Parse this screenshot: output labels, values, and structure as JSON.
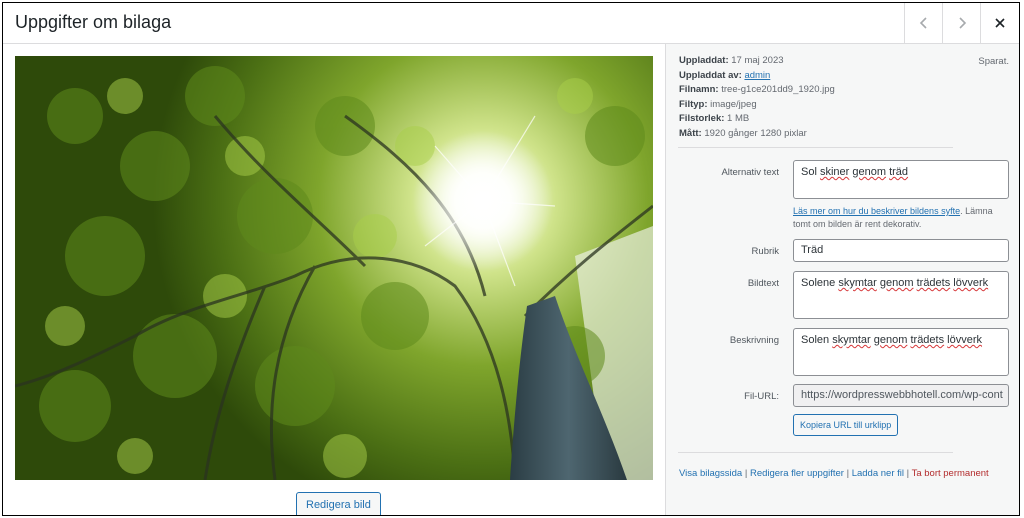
{
  "modal": {
    "title": "Uppgifter om bilaga",
    "prev_icon": "chevron-left-icon",
    "next_icon": "chevron-right-icon",
    "close_icon": "close-icon"
  },
  "image": {
    "alt": "Sol skiner genom träd",
    "edit_button": "Redigera bild"
  },
  "details": {
    "saved": "Sparat.",
    "uploaded_label": "Uppladdat:",
    "uploaded_value": "17 maj 2023",
    "uploaded_by_label": "Uppladdat av:",
    "uploaded_by_value": "admin",
    "filename_label": "Filnamn:",
    "filename_value": "tree-g1ce201dd9_1920.jpg",
    "filetype_label": "Filtyp:",
    "filetype_value": "image/jpeg",
    "filesize_label": "Filstorlek:",
    "filesize_value": "1 MB",
    "dimensions_label": "Mått:",
    "dimensions_value": "1920 gånger 1280 pixlar"
  },
  "form": {
    "alt_label": "Alternativ text",
    "alt_value_word1": "Sol",
    "alt_value_word2": "skiner",
    "alt_value_word3": "genom",
    "alt_value_word4": "träd",
    "help_link": "Läs mer om hur du beskriver bildens syfte",
    "help_text": ". Lämna tomt om bilden är rent dekorativ.",
    "title_label": "Rubrik",
    "title_value": "Träd",
    "caption_label": "Bildtext",
    "caption_w1": "Solene",
    "caption_w2": "skymtar",
    "caption_w3": "genom",
    "caption_w4": "trädets",
    "caption_w5": "lövverk",
    "description_label": "Beskrivning",
    "description_w1": "Solen",
    "description_w2": "skymtar",
    "description_w3": "genom",
    "description_w4": "trädets",
    "description_w5": "lövverk",
    "url_label": "Fil-URL:",
    "url_value": "https://wordpresswebbhotell.com/wp-cont",
    "copy_button": "Kopiera URL till urklipp"
  },
  "actions": {
    "view": "Visa bilagssida",
    "edit_more": "Redigera fler uppgifter",
    "download": "Ladda ner fil",
    "delete": "Ta bort permanent",
    "sep": "|"
  }
}
